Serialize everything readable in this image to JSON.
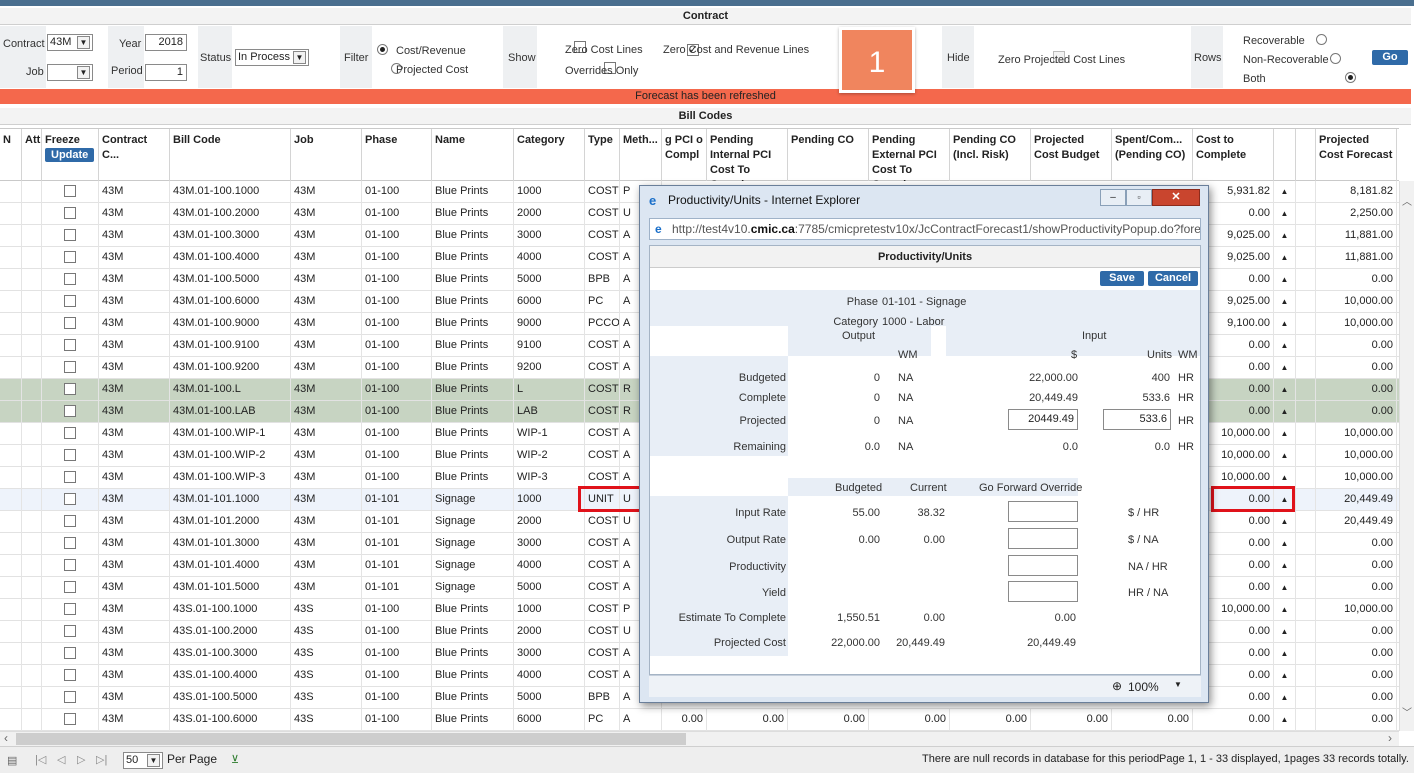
{
  "contract_section": {
    "title": "Contract",
    "contract_label": "Contract",
    "contract_value": "43M",
    "year_label": "Year",
    "year_value": "2018",
    "job_label": "Job",
    "job_value": "",
    "period_label": "Period",
    "period_value": "1",
    "status_label": "Status",
    "status_value": "In Process",
    "filter_label": "Filter",
    "filter_cost_revenue": "Cost/Revenue",
    "filter_projected_cost": "Projected Cost",
    "show_label": "Show",
    "show_zero_cost": "Zero Cost Lines",
    "show_zero_cost_revenue": "Zero Cost and Revenue Lines",
    "show_overrides": "Overrides Only",
    "hide_label": "Hide",
    "hide_zero_projected": "Zero Projected Cost Lines",
    "rows_label": "Rows",
    "rows_recoverable": "Recoverable",
    "rows_non_recoverable": "Non-Recoverable",
    "rows_both": "Both",
    "go_label": "Go"
  },
  "badge": {
    "number": "1"
  },
  "refresh_message": "Forecast has been refreshed",
  "bill_codes_title": "Bill Codes",
  "grid": {
    "headers": {
      "n": "N",
      "att": "Att",
      "freeze": "Freeze",
      "update": "Update",
      "contract": "Contract C...",
      "bill_code": "Bill Code",
      "job": "Job",
      "phase": "Phase",
      "name": "Name",
      "category": "Category",
      "type": "Type",
      "method": "Meth...",
      "pending_pci": "g PCI o Compl",
      "pending_internal": "Pending Internal PCI Cost To Compl",
      "pending_co": "Pending CO",
      "pending_external": "Pending External PCI Cost To Compl",
      "pending_co_risk": "Pending CO (Incl. Risk)",
      "projected_budget": "Projected Cost Budget",
      "spent_committed": "Spent/Com... (Pending CO)",
      "cost_to_complete": "Cost to Complete",
      "projected_forecast": "Projected Cost Forecast"
    },
    "rows": [
      {
        "contract": "43M",
        "bill": "43M.01-100.1000",
        "job": "43M",
        "phase": "01-100",
        "name": "Blue Prints",
        "cat": "1000",
        "type": "COST",
        "meth": "P",
        "ctc": "5,931.82",
        "pcf": "8,181.82",
        "style": ""
      },
      {
        "contract": "43M",
        "bill": "43M.01-100.2000",
        "job": "43M",
        "phase": "01-100",
        "name": "Blue Prints",
        "cat": "2000",
        "type": "COST",
        "meth": "U",
        "ctc": "0.00",
        "pcf": "2,250.00",
        "style": ""
      },
      {
        "contract": "43M",
        "bill": "43M.01-100.3000",
        "job": "43M",
        "phase": "01-100",
        "name": "Blue Prints",
        "cat": "3000",
        "type": "COST",
        "meth": "A",
        "ctc": "9,025.00",
        "pcf": "11,881.00",
        "style": ""
      },
      {
        "contract": "43M",
        "bill": "43M.01-100.4000",
        "job": "43M",
        "phase": "01-100",
        "name": "Blue Prints",
        "cat": "4000",
        "type": "COST",
        "meth": "A",
        "ctc": "9,025.00",
        "pcf": "11,881.00",
        "style": ""
      },
      {
        "contract": "43M",
        "bill": "43M.01-100.5000",
        "job": "43M",
        "phase": "01-100",
        "name": "Blue Prints",
        "cat": "5000",
        "type": "BPB",
        "meth": "A",
        "ctc": "0.00",
        "pcf": "0.00",
        "style": ""
      },
      {
        "contract": "43M",
        "bill": "43M.01-100.6000",
        "job": "43M",
        "phase": "01-100",
        "name": "Blue Prints",
        "cat": "6000",
        "type": "PC",
        "meth": "A",
        "ctc": "9,025.00",
        "pcf": "10,000.00",
        "style": ""
      },
      {
        "contract": "43M",
        "bill": "43M.01-100.9000",
        "job": "43M",
        "phase": "01-100",
        "name": "Blue Prints",
        "cat": "9000",
        "type": "PCCO",
        "meth": "A",
        "ctc": "9,100.00",
        "pcf": "10,000.00",
        "style": ""
      },
      {
        "contract": "43M",
        "bill": "43M.01-100.9100",
        "job": "43M",
        "phase": "01-100",
        "name": "Blue Prints",
        "cat": "9100",
        "type": "COST",
        "meth": "A",
        "ctc": "0.00",
        "pcf": "0.00",
        "style": ""
      },
      {
        "contract": "43M",
        "bill": "43M.01-100.9200",
        "job": "43M",
        "phase": "01-100",
        "name": "Blue Prints",
        "cat": "9200",
        "type": "COST",
        "meth": "A",
        "ctc": "0.00",
        "pcf": "0.00",
        "style": ""
      },
      {
        "contract": "43M",
        "bill": "43M.01-100.L",
        "job": "43M",
        "phase": "01-100",
        "name": "Blue Prints",
        "cat": "L",
        "type": "COST",
        "meth": "R",
        "ctc": "0.00",
        "pcf": "0.00",
        "style": "green"
      },
      {
        "contract": "43M",
        "bill": "43M.01-100.LAB",
        "job": "43M",
        "phase": "01-100",
        "name": "Blue Prints",
        "cat": "LAB",
        "type": "COST",
        "meth": "R",
        "ctc": "0.00",
        "pcf": "0.00",
        "style": "green"
      },
      {
        "contract": "43M",
        "bill": "43M.01-100.WIP-1",
        "job": "43M",
        "phase": "01-100",
        "name": "Blue Prints",
        "cat": "WIP-1",
        "type": "COST",
        "meth": "A",
        "ctc": "10,000.00",
        "pcf": "10,000.00",
        "style": ""
      },
      {
        "contract": "43M",
        "bill": "43M.01-100.WIP-2",
        "job": "43M",
        "phase": "01-100",
        "name": "Blue Prints",
        "cat": "WIP-2",
        "type": "COST",
        "meth": "A",
        "ctc": "10,000.00",
        "pcf": "10,000.00",
        "style": ""
      },
      {
        "contract": "43M",
        "bill": "43M.01-100.WIP-3",
        "job": "43M",
        "phase": "01-100",
        "name": "Blue Prints",
        "cat": "WIP-3",
        "type": "COST",
        "meth": "A",
        "ctc": "10,000.00",
        "pcf": "10,000.00",
        "style": ""
      },
      {
        "contract": "43M",
        "bill": "43M.01-101.1000",
        "job": "43M",
        "phase": "01-101",
        "name": "Signage",
        "cat": "1000",
        "type": "UNIT",
        "meth": "U",
        "ctc": "0.00",
        "pcf": "20,449.49",
        "style": "sel-row"
      },
      {
        "contract": "43M",
        "bill": "43M.01-101.2000",
        "job": "43M",
        "phase": "01-101",
        "name": "Signage",
        "cat": "2000",
        "type": "COST",
        "meth": "U",
        "ctc": "0.00",
        "pcf": "20,449.49",
        "style": ""
      },
      {
        "contract": "43M",
        "bill": "43M.01-101.3000",
        "job": "43M",
        "phase": "01-101",
        "name": "Signage",
        "cat": "3000",
        "type": "COST",
        "meth": "A",
        "ctc": "0.00",
        "pcf": "0.00",
        "style": ""
      },
      {
        "contract": "43M",
        "bill": "43M.01-101.4000",
        "job": "43M",
        "phase": "01-101",
        "name": "Signage",
        "cat": "4000",
        "type": "COST",
        "meth": "A",
        "ctc": "0.00",
        "pcf": "0.00",
        "style": ""
      },
      {
        "contract": "43M",
        "bill": "43M.01-101.5000",
        "job": "43M",
        "phase": "01-101",
        "name": "Signage",
        "cat": "5000",
        "type": "COST",
        "meth": "A",
        "ctc": "0.00",
        "pcf": "0.00",
        "style": ""
      },
      {
        "contract": "43M",
        "bill": "43S.01-100.1000",
        "job": "43S",
        "phase": "01-100",
        "name": "Blue Prints",
        "cat": "1000",
        "type": "COST",
        "meth": "P",
        "ctc": "10,000.00",
        "pcf": "10,000.00",
        "style": ""
      },
      {
        "contract": "43M",
        "bill": "43S.01-100.2000",
        "job": "43S",
        "phase": "01-100",
        "name": "Blue Prints",
        "cat": "2000",
        "type": "COST",
        "meth": "U",
        "ctc": "0.00",
        "pcf": "0.00",
        "style": ""
      },
      {
        "contract": "43M",
        "bill": "43S.01-100.3000",
        "job": "43S",
        "phase": "01-100",
        "name": "Blue Prints",
        "cat": "3000",
        "type": "COST",
        "meth": "A",
        "ctc": "0.00",
        "pcf": "0.00",
        "style": ""
      },
      {
        "contract": "43M",
        "bill": "43S.01-100.4000",
        "job": "43S",
        "phase": "01-100",
        "name": "Blue Prints",
        "cat": "4000",
        "type": "COST",
        "meth": "A",
        "ctc": "0.00",
        "pcf": "0.00",
        "style": ""
      },
      {
        "contract": "43M",
        "bill": "43S.01-100.5000",
        "job": "43S",
        "phase": "01-100",
        "name": "Blue Prints",
        "cat": "5000",
        "type": "BPB",
        "meth": "A",
        "ctc": "0.00",
        "pcf": "0.00",
        "style": ""
      },
      {
        "contract": "43M",
        "bill": "43S.01-100.6000",
        "job": "43S",
        "phase": "01-100",
        "name": "Blue Prints",
        "cat": "6000",
        "type": "PC",
        "meth": "A",
        "ctc": "0.00",
        "pcf": "0.00",
        "style": ""
      }
    ],
    "last_row_extra": [
      "0.00",
      "0.00",
      "0.00",
      "0.00",
      "0.00",
      "0.00",
      "0.00"
    ]
  },
  "footer": {
    "per_page_value": "50",
    "per_page_label": "Per Page",
    "null_message": "There are null records in database for this period.",
    "page_info": "Page 1, 1 - 33 displayed, 1pages 33 records totally."
  },
  "popup": {
    "window_title": "Productivity/Units - Internet Explorer",
    "url_prefix": "http://test4v10.",
    "url_host": "cmic.ca",
    "url_rest": ":7785/cmicpretestv10x/JcContractForecast1/showProductivityPopup.do?fore",
    "heading": "Productivity/Units",
    "save_label": "Save",
    "cancel_label": "Cancel",
    "phase_label": "Phase",
    "phase_value": "01-101 - Signage",
    "category_label": "Category",
    "category_value": "1000 - Labor",
    "output_label": "Output",
    "input_label": "Input",
    "wm_label": "WM",
    "dollar_label": "$",
    "units_label": "Units",
    "rows": [
      {
        "label": "Budgeted",
        "out": "0",
        "out_wm": "NA",
        "in_dollar": "22,000.00",
        "in_units": "400",
        "in_wm": "HR"
      },
      {
        "label": "Complete",
        "out": "0",
        "out_wm": "NA",
        "in_dollar": "20,449.49",
        "in_units": "533.6",
        "in_wm": "HR"
      },
      {
        "label": "Projected",
        "out": "0",
        "out_wm": "NA",
        "in_dollar": "20449.49",
        "in_units": "533.6",
        "in_wm": "HR"
      },
      {
        "label": "Remaining",
        "out": "0.0",
        "out_wm": "NA",
        "in_dollar": "0.0",
        "in_units": "0.0",
        "in_wm": "HR"
      }
    ],
    "rate_headers": {
      "budgeted": "Budgeted",
      "current": "Current",
      "override": "Go Forward Override"
    },
    "rates": [
      {
        "label": "Input Rate",
        "budgeted": "55.00",
        "current": "38.32",
        "unit": "$ / HR"
      },
      {
        "label": "Output Rate",
        "budgeted": "0.00",
        "current": "0.00",
        "unit": "$ / NA"
      },
      {
        "label": "Productivity",
        "budgeted": "",
        "current": "",
        "unit": "NA / HR"
      },
      {
        "label": "Yield",
        "budgeted": "",
        "current": "",
        "unit": "HR / NA"
      }
    ],
    "etc": {
      "label": "Estimate To Complete",
      "budgeted": "1,550.51",
      "current": "0.00",
      "override": "0.00"
    },
    "projected_cost": {
      "label": "Projected Cost",
      "budgeted": "22,000.00",
      "current": "20,449.49",
      "override": "20,449.49"
    },
    "zoom": "100%"
  }
}
